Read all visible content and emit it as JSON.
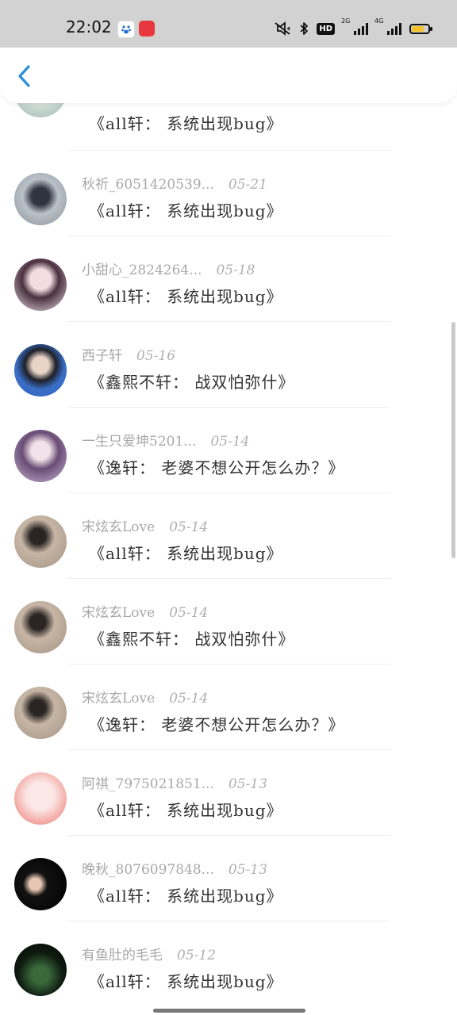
{
  "status_bar": {
    "time": "22:02",
    "hd_label": "HD",
    "signal1_label": "2G",
    "signal2_label": "4G",
    "battery_level": 0.7,
    "battery_color": "#f3c22c"
  },
  "header": {
    "back_icon": "chevron-left-icon",
    "accent": "#2a8fd8"
  },
  "messages": [
    {
      "name": "",
      "date": "",
      "text": "《all轩： 系统出现bug》"
    },
    {
      "name": "秋祈_6051420539...",
      "date": "05-21",
      "text": "《all轩： 系统出现bug》"
    },
    {
      "name": "小甜心_2824264...",
      "date": "05-18",
      "text": "《all轩： 系统出现bug》"
    },
    {
      "name": "西子轩",
      "date": "05-16",
      "text": "《鑫熙不轩： 战双怕弥什》"
    },
    {
      "name": "一生只爱坤5201...",
      "date": "05-14",
      "text": "《逸轩： 老婆不想公开怎么办？》"
    },
    {
      "name": "宋炫玄Love",
      "date": "05-14",
      "text": "《all轩： 系统出现bug》"
    },
    {
      "name": "宋炫玄Love",
      "date": "05-14",
      "text": "《鑫熙不轩： 战双怕弥什》"
    },
    {
      "name": "宋炫玄Love",
      "date": "05-14",
      "text": "《逸轩： 老婆不想公开怎么办？》"
    },
    {
      "name": "阿祺_7975021851...",
      "date": "05-13",
      "text": "《all轩： 系统出现bug》"
    },
    {
      "name": "晚秋_8076097848...",
      "date": "05-13",
      "text": "《all轩： 系统出现bug》"
    },
    {
      "name": "有鱼肚的毛毛",
      "date": "05-12",
      "text": "《all轩： 系统出现bug》"
    }
  ]
}
